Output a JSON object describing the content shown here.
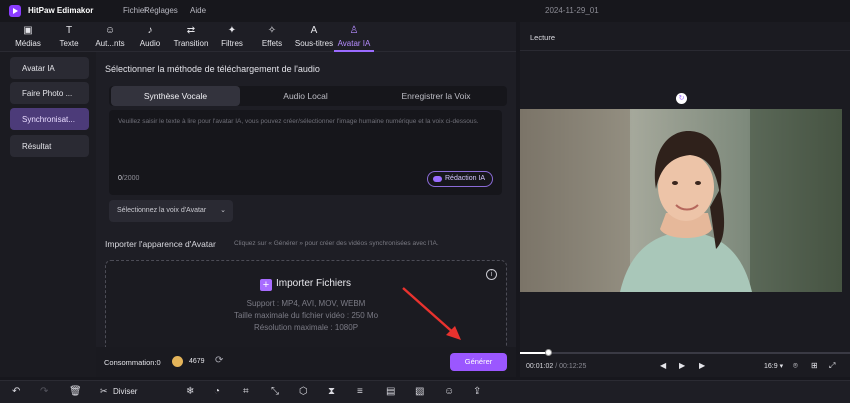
{
  "app": {
    "title": "HitPaw Edimakor",
    "document_title": "2024-11-29_01"
  },
  "menu": [
    "Fichier",
    "Réglages",
    "Aide"
  ],
  "toolbar": {
    "tabs": [
      {
        "label": "Médias",
        "icon": "image-icon"
      },
      {
        "label": "Texte",
        "icon": "text-icon"
      },
      {
        "label": "Aut...nts",
        "icon": "music-note-icon"
      },
      {
        "label": "Audio",
        "icon": "audio-icon"
      },
      {
        "label": "Transition",
        "icon": "transition-icon"
      },
      {
        "label": "Filtres",
        "icon": "sparkle-icon"
      },
      {
        "label": "Effets",
        "icon": "magic-wand-icon"
      },
      {
        "label": "Sous-titres",
        "icon": "subtitle-icon"
      },
      {
        "label": "Avatar IA",
        "icon": "avatar-icon"
      }
    ],
    "active": "Avatar IA"
  },
  "sidebar": {
    "items": [
      {
        "label": "Avatar IA"
      },
      {
        "label": "Faire Photo ..."
      },
      {
        "label": "Synchronisat..."
      },
      {
        "label": "Résultat"
      }
    ],
    "selected_index": 2
  },
  "main": {
    "section_title": "Sélectionner la méthode de téléchargement de l'audio",
    "method_tabs": [
      "Synthèse Vocale",
      "Audio Local",
      "Enregistrer la Voix"
    ],
    "method_selected": 0,
    "text_placeholder": "Veuillez saisir le texte à lire pour l'avatar IA, vous pouvez créer/sélectionner l'image humaine numérique et la voix ci-dessous.",
    "char_count": "0",
    "char_max": "/2000",
    "redaction_label": "Rédaction IA",
    "voice_select": "Sélectionnez la voix d'Avatar",
    "import_title": "Importer l'apparence d'Avatar",
    "import_hint": "Cliquez sur « Générer » pour créer des vidéos synchronisées avec l'IA.",
    "import_button": "Importer Fichiers",
    "support": "Support : MP4, AVI, MOV, WEBM",
    "max_size": "Taille maximale du fichier vidéo : 250 Mo",
    "max_resolution": "Résolution maximale : 1080P"
  },
  "footer": {
    "consumption_label": "Consommation:0",
    "credits": "4679",
    "generate_label": "Générer"
  },
  "preview": {
    "title": "Lecture",
    "current_time": "00:01:02",
    "total_time": "/ 00:12:25",
    "progress": 0.08,
    "aspect": "16:9"
  },
  "bottom_toolbar": {
    "split_label": "Diviser"
  },
  "colors": {
    "accent": "#9b57ff",
    "background": "#1e1e25"
  }
}
